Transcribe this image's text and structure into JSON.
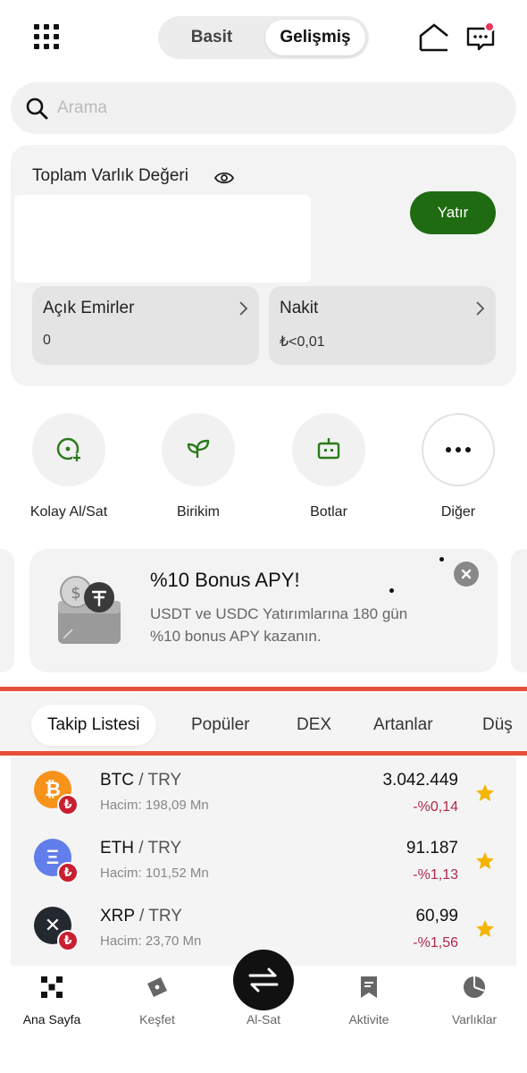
{
  "header": {
    "mode_simple": "Basit",
    "mode_advanced": "Gelişmiş",
    "active_mode": "Gelişmiş",
    "icons": [
      "grid-menu-icon",
      "home-icon",
      "chat-icon"
    ],
    "notification_dot_color": "#e8375a"
  },
  "search": {
    "placeholder": "Arama"
  },
  "assets": {
    "title": "Toplam Varlık Değeri",
    "deposit_label": "Yatır",
    "open_orders": {
      "label": "Açık Emirler",
      "value": "0"
    },
    "cash": {
      "label": "Nakit",
      "value": "₺<0,01"
    }
  },
  "shortcuts": [
    {
      "label": "Kolay Al/Sat",
      "icon": "easy-trade-icon"
    },
    {
      "label": "Birikim",
      "icon": "leaf-icon"
    },
    {
      "label": "Botlar",
      "icon": "bot-icon"
    },
    {
      "label": "Diğer",
      "icon": "more-icon"
    }
  ],
  "promo": {
    "title": "%10 Bonus APY!",
    "description": "USDT ve USDC Yatırımlarına 180 gün %10 bonus APY kazanın."
  },
  "market_tabs": [
    "Takip Listesi",
    "Popüler",
    "DEX",
    "Artanlar",
    "Düş"
  ],
  "active_tab": "Takip Listesi",
  "markets": [
    {
      "base": "BTC",
      "quote": " / TRY",
      "volume": "Hacim: 198,09 Mn",
      "price": "3.042.449",
      "change": "-%0,14",
      "starred": true,
      "icon_color": "#f7931a",
      "symbol": "₿"
    },
    {
      "base": "ETH",
      "quote": " / TRY",
      "volume": "Hacim: 101,52 Mn",
      "price": "91.187",
      "change": "-%1,13",
      "starred": true,
      "icon_color": "#627eea",
      "symbol": "Ξ"
    },
    {
      "base": "XRP",
      "quote": " / TRY",
      "volume": "Hacim: 23,70 Mn",
      "price": "60,99",
      "change": "-%1,56",
      "starred": true,
      "icon_color": "#23292f",
      "symbol": "✕"
    }
  ],
  "bottom_nav": [
    {
      "label": "Ana Sayfa",
      "icon": "home-grid-icon",
      "active": true
    },
    {
      "label": "Keşfet",
      "icon": "compass-icon",
      "active": false
    },
    {
      "label": "Al-Sat",
      "icon": "swap-icon",
      "active": false
    },
    {
      "label": "Aktivite",
      "icon": "activity-icon",
      "active": false
    },
    {
      "label": "Varlıklar",
      "icon": "pie-chart-icon",
      "active": false
    }
  ],
  "colors": {
    "accent_green": "#1f6b12",
    "negative": "#b0284a",
    "star": "#f5b400",
    "highlight_line": "#e5503b"
  }
}
